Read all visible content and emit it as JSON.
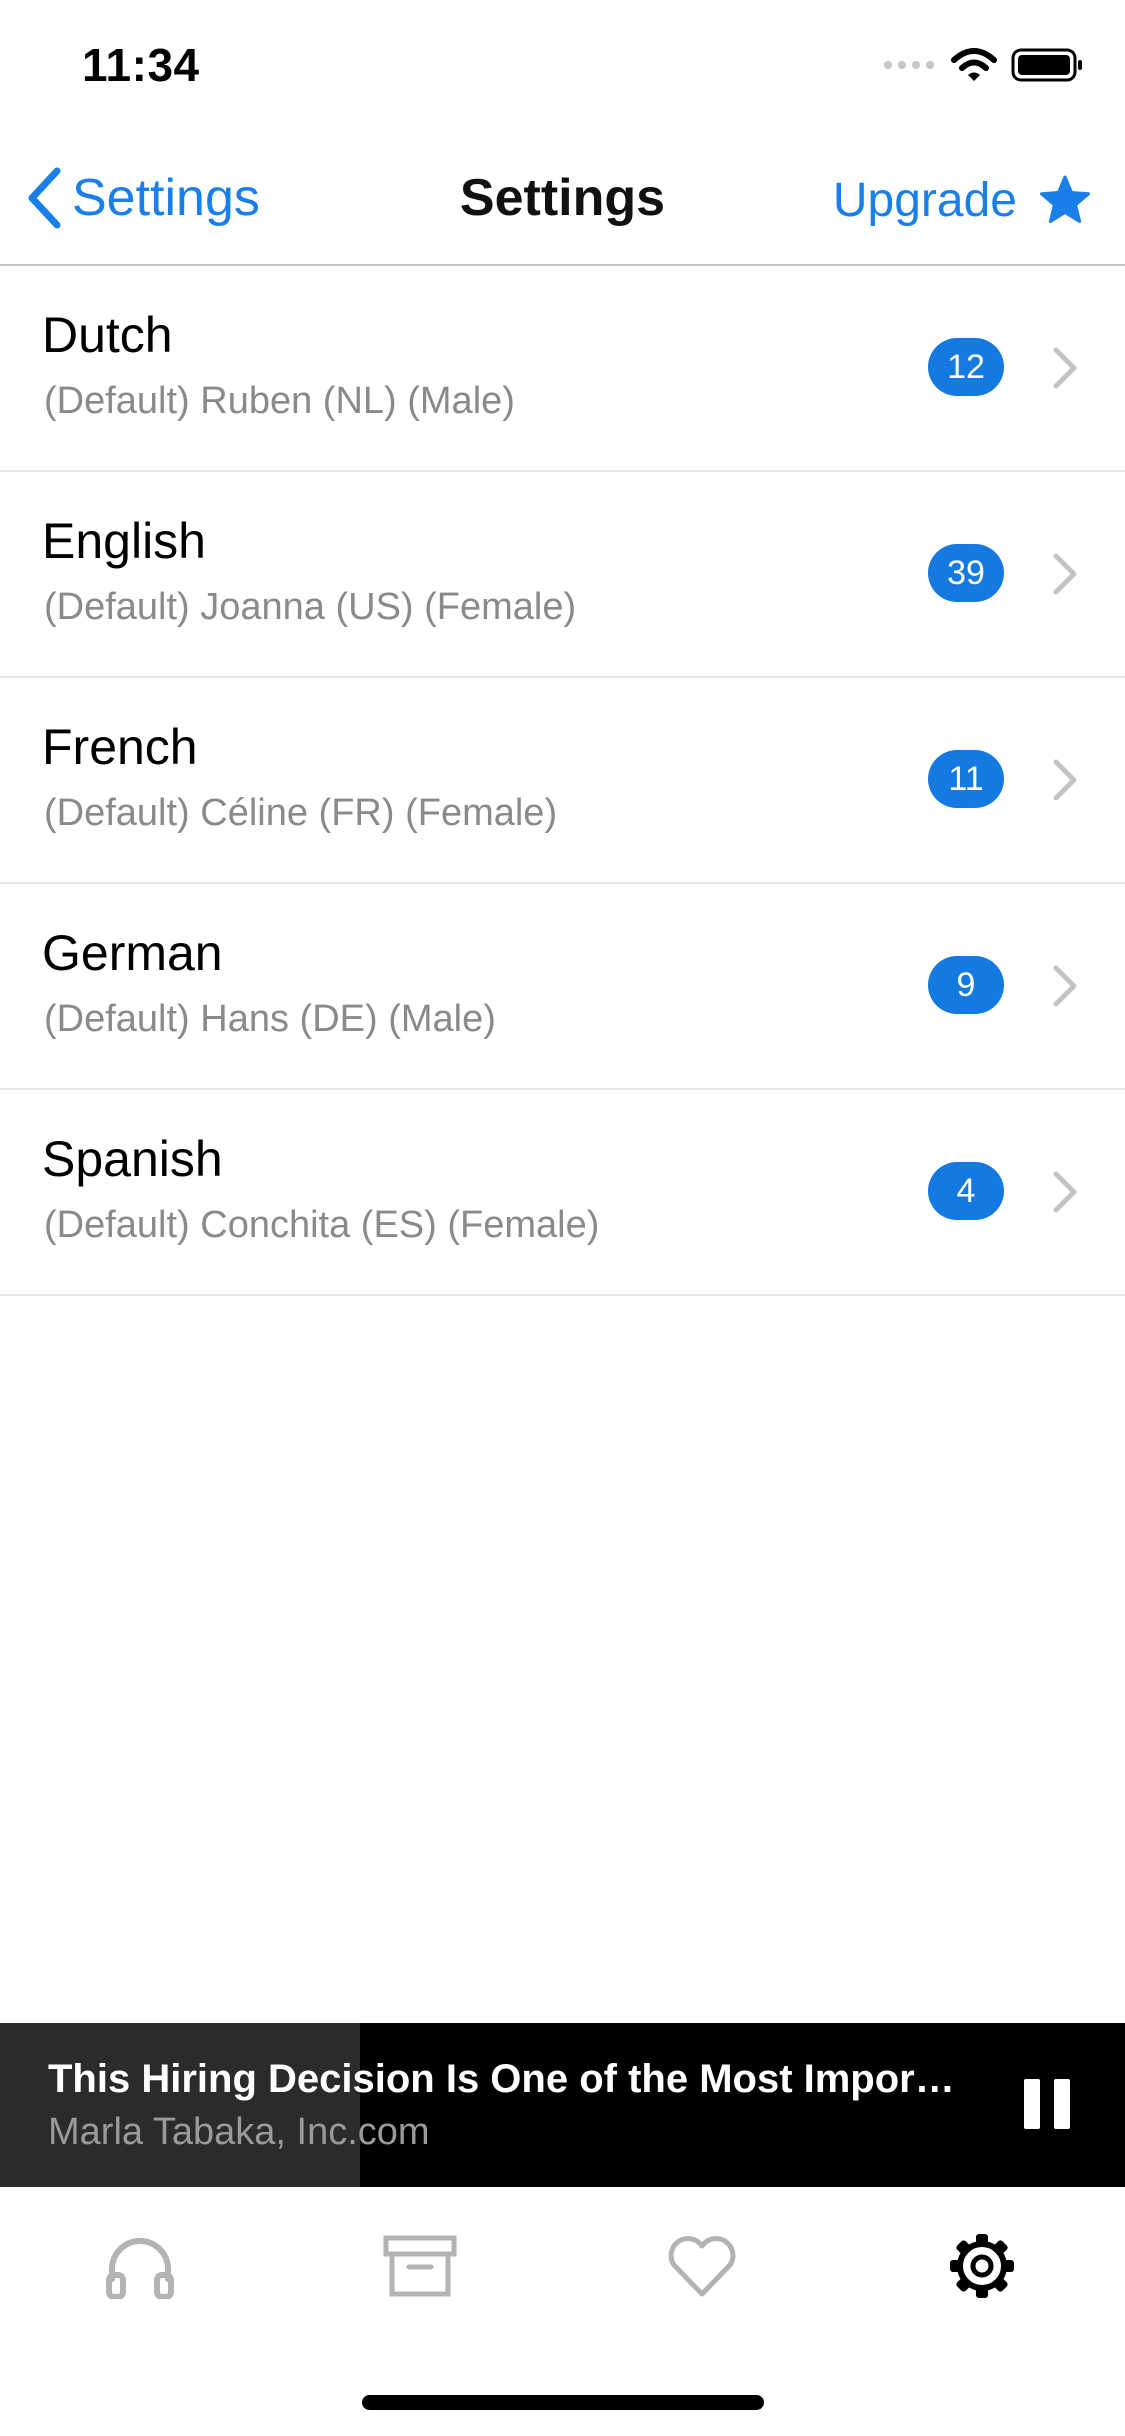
{
  "status_bar": {
    "time": "11:34"
  },
  "nav": {
    "back_label": "Settings",
    "title": "Settings",
    "upgrade_label": "Upgrade"
  },
  "languages": [
    {
      "name": "Dutch",
      "voice": "(Default) Ruben (NL) (Male)",
      "count": "12"
    },
    {
      "name": "English",
      "voice": "(Default) Joanna (US) (Female)",
      "count": "39"
    },
    {
      "name": "French",
      "voice": "(Default) Céline (FR) (Female)",
      "count": "11"
    },
    {
      "name": "German",
      "voice": "(Default) Hans (DE) (Male)",
      "count": "9"
    },
    {
      "name": "Spanish",
      "voice": "(Default) Conchita (ES) (Female)",
      "count": "4"
    }
  ],
  "player": {
    "title": "This Hiring Decision Is One of the Most Important Decisions You'll Make",
    "subtitle": "Marla Tabaka, Inc.com",
    "progress": 0.32
  },
  "tabs": [
    {
      "icon": "headphones-icon",
      "active": false
    },
    {
      "icon": "archive-icon",
      "active": false
    },
    {
      "icon": "heart-icon",
      "active": false
    },
    {
      "icon": "gear-icon",
      "active": true
    }
  ],
  "colors": {
    "accent": "#1a7fe8",
    "badge": "#1479e0",
    "inactive_tab": "#b3b3b3"
  }
}
